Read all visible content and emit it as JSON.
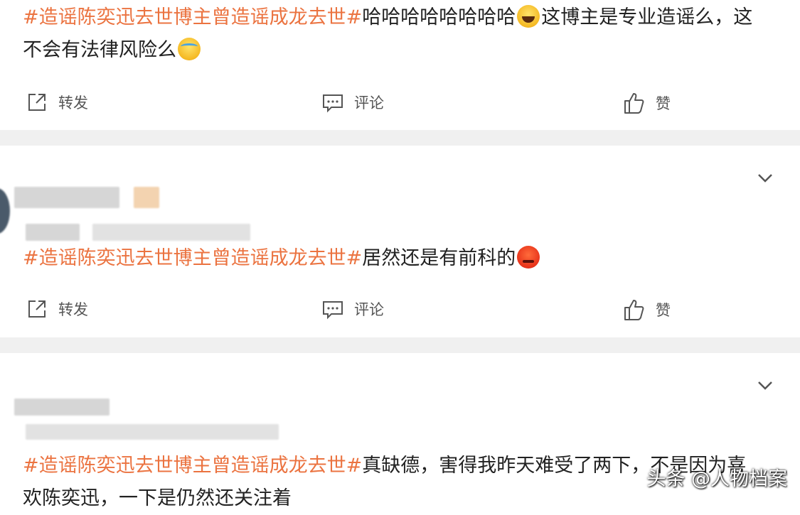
{
  "posts": [
    {
      "topic": "#造谣陈奕迅去世博主曾造谣成龙去世#",
      "text1": "哈哈哈哈哈哈哈哈",
      "emoji1": "laughing-tears-emoji",
      "text2": "这博主是专业造谣么，这",
      "text3": "不会有法律风险么",
      "emoji2": "crying-emoji",
      "actions": {
        "repost": "转发",
        "comment": "评论",
        "like": "赞"
      }
    },
    {
      "topic": "#造谣陈奕迅去世博主曾造谣成龙去世#",
      "text1": "居然还是有前科的",
      "emoji1": "angry-emoji",
      "actions": {
        "repost": "转发",
        "comment": "评论",
        "like": "赞"
      }
    },
    {
      "topic": "#造谣陈奕迅去世博主曾造谣成龙去世#",
      "text1": "真缺德，害得我昨天难受了两下，不是因为喜",
      "text2": "欢陈奕迅，一下是仍然还关注着"
    }
  ],
  "watermark": "头条 @人物档案",
  "colors": {
    "topic": "#eb7340",
    "separator": "#f0f0f0",
    "icon": "#555555"
  }
}
